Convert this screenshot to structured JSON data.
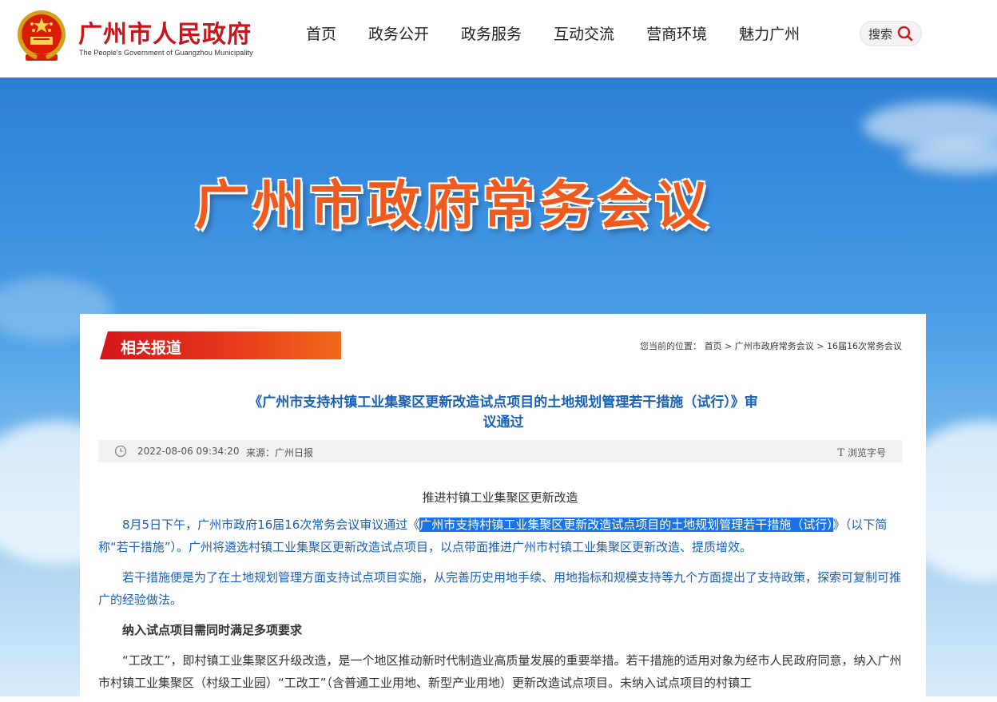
{
  "header": {
    "site_title": "广州市人民政府",
    "site_subtitle": "The People's Government of Guangzhou Municipality",
    "nav": [
      "首页",
      "政务公开",
      "政务服务",
      "互动交流",
      "营商环境",
      "魅力广州"
    ],
    "search_label": "搜索"
  },
  "banner": {
    "title": "广州市政府常务会议"
  },
  "section": {
    "tag": "相关报道"
  },
  "breadcrumb": {
    "prefix": "您当前的位置：",
    "items": [
      "首页",
      "广州市政府常务会议",
      "16届16次常务会议"
    ],
    "separator": ">"
  },
  "article": {
    "title": "《广州市支持村镇工业集聚区更新改造试点项目的土地规划管理若干措施（试行）》审议通过",
    "date": "2022-08-06 09:34:20",
    "source": "来源：广州日报",
    "font_control": "浏览字号",
    "subtitle": "推进村镇工业集聚区更新改造",
    "p1_before": "8月5日下午，广州市政府16届16次常务会议审议通过《",
    "p1_highlight": "广州市支持村镇工业集聚区更新改造试点项目的土地规划管理若干措施（试行）",
    "p1_after": "》（以下简称“若干措施”）。广州将遴选村镇工业集聚区更新改造试点项目，以点带面推进广州市村镇工业集聚区更新改造、提质增效。",
    "p2": "若干措施便是为了在土地规划管理方面支持试点项目实施，从完善历史用地手续、用地指标和规模支持等九个方面提出了支持政策，探索可复制可推广的经验做法。",
    "heading2": "纳入试点项目需同时满足多项要求",
    "p3": "“工改工”，即村镇工业集聚区升级改造，是一个地区推动新时代制造业高质量发展的重要举措。若干措施的适用对象为经市人民政府同意，纳入广州市村镇工业集聚区（村级工业园）“工改工”（含普通工业用地、新型产业用地）更新改造试点项目。未纳入试点项目的村镇工"
  },
  "colors": {
    "brand_red": "#c8161d",
    "link_blue": "#1861b5",
    "highlight": "#1a73e8",
    "tag_orange": "#f26a1a"
  }
}
